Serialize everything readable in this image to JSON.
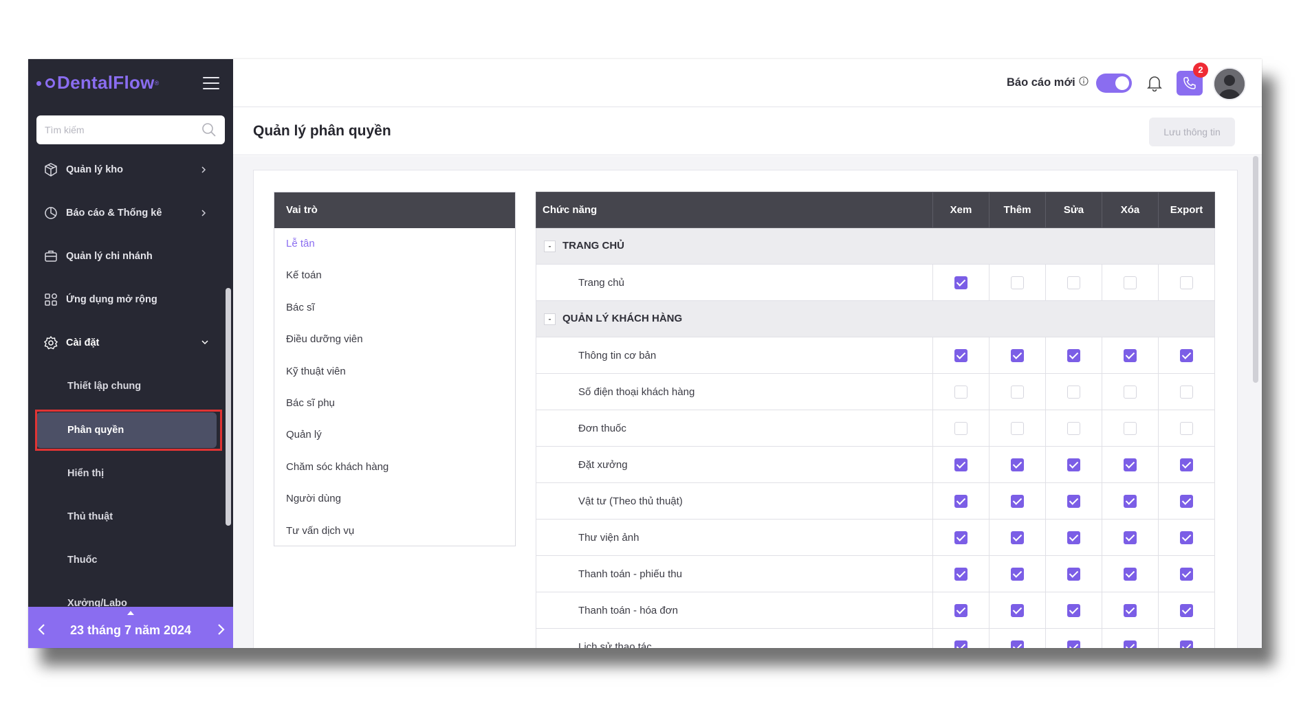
{
  "brand": {
    "name": "DentalFlow",
    "reg": "®"
  },
  "sidebar": {
    "search_placeholder": "Tìm kiếm",
    "items": [
      {
        "label": "Quản lý kho"
      },
      {
        "label": "Báo cáo & Thống kê"
      },
      {
        "label": "Quản lý chi nhánh"
      },
      {
        "label": "Ứng dụng mở rộng"
      },
      {
        "label": "Cài đặt"
      }
    ],
    "sub_items": [
      {
        "label": "Thiết lập chung"
      },
      {
        "label": "Phân quyền"
      },
      {
        "label": "Hiển thị"
      },
      {
        "label": "Thủ thuật"
      },
      {
        "label": "Thuốc"
      },
      {
        "label": "Xưởng/Labo"
      }
    ],
    "date": "23 tháng 7 năm 2024"
  },
  "header": {
    "report_label": "Báo cáo mới",
    "notification_badge": "2"
  },
  "page": {
    "title": "Quản lý phân quyền",
    "save_label": "Lưu thông tin"
  },
  "roles": {
    "header": "Vai trò",
    "items": [
      "Lễ tân",
      "Kế toán",
      "Bác sĩ",
      "Điều dưỡng viên",
      "Kỹ thuật viên",
      "Bác sĩ phụ",
      "Quản lý",
      "Chăm sóc khách hàng",
      "Người dùng",
      "Tư vấn dịch vụ"
    ]
  },
  "permissions": {
    "headers": {
      "function": "Chức năng",
      "view": "Xem",
      "add": "Thêm",
      "edit": "Sửa",
      "delete": "Xóa",
      "export": "Export"
    },
    "groups": [
      {
        "label": "TRANG CHỦ",
        "rows": [
          {
            "label": "Trang chủ",
            "checks": [
              true,
              false,
              false,
              false,
              false
            ]
          }
        ]
      },
      {
        "label": "QUẢN LÝ KHÁCH HÀNG",
        "rows": [
          {
            "label": "Thông tin cơ bản",
            "checks": [
              true,
              true,
              true,
              true,
              true
            ]
          },
          {
            "label": "Số điện thoại khách hàng",
            "checks": [
              false,
              false,
              false,
              false,
              false
            ]
          },
          {
            "label": "Đơn thuốc",
            "checks": [
              false,
              false,
              false,
              false,
              false
            ]
          },
          {
            "label": "Đặt xưởng",
            "checks": [
              true,
              true,
              true,
              true,
              true
            ]
          },
          {
            "label": "Vật tư (Theo thủ thuật)",
            "checks": [
              true,
              true,
              true,
              true,
              true
            ]
          },
          {
            "label": "Thư viện ảnh",
            "checks": [
              true,
              true,
              true,
              true,
              true
            ]
          },
          {
            "label": "Thanh toán - phiếu thu",
            "checks": [
              true,
              true,
              true,
              true,
              true
            ]
          },
          {
            "label": "Thanh toán - hóa đơn",
            "checks": [
              true,
              true,
              true,
              true,
              true
            ]
          },
          {
            "label": "Lịch sử thao tác",
            "checks": [
              true,
              true,
              true,
              true,
              true
            ]
          }
        ]
      }
    ]
  },
  "colors": {
    "accent": "#8a6df0",
    "sidebar_bg": "#272833",
    "table_header": "#45454d",
    "badge": "#ef2b35",
    "highlight_frame": "#e03434"
  }
}
